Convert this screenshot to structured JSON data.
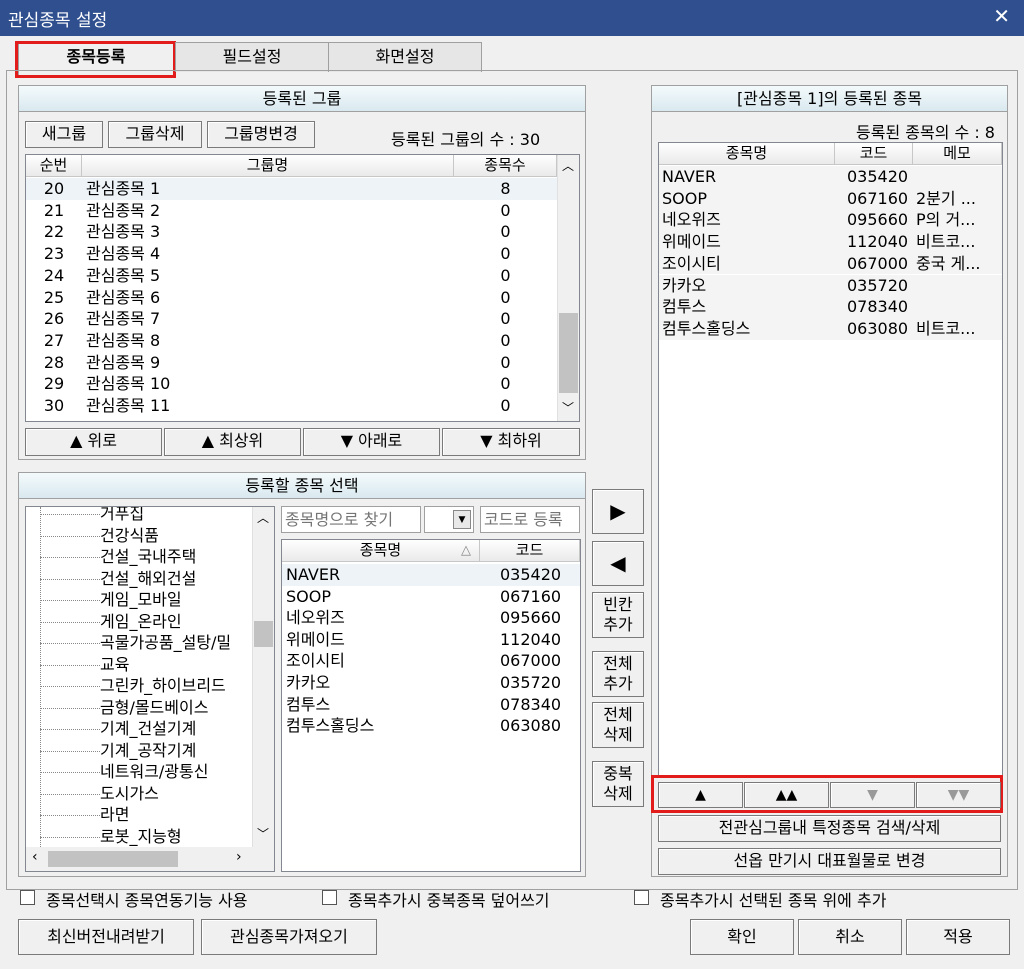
{
  "window": {
    "title": "관심종목 설정",
    "close": "✕"
  },
  "tabs": [
    {
      "label": "종목등록",
      "active": true
    },
    {
      "label": "필드설정",
      "active": false
    },
    {
      "label": "화면설정",
      "active": false
    }
  ],
  "groups": {
    "title": "등록된 그룹",
    "buttons": {
      "new": "새그룹",
      "delete": "그룹삭제",
      "rename": "그룹명변경"
    },
    "count_label": "등록된 그룹의 수 : 30",
    "columns": [
      "순번",
      "그룹명",
      "종목수"
    ],
    "rows": [
      [
        "20",
        "관심종목 1",
        "8"
      ],
      [
        "21",
        "관심종목 2",
        "0"
      ],
      [
        "22",
        "관심종목 3",
        "0"
      ],
      [
        "23",
        "관심종목 4",
        "0"
      ],
      [
        "24",
        "관심종목 5",
        "0"
      ],
      [
        "25",
        "관심종목 6",
        "0"
      ],
      [
        "26",
        "관심종목 7",
        "0"
      ],
      [
        "27",
        "관심종목 8",
        "0"
      ],
      [
        "28",
        "관심종목 9",
        "0"
      ],
      [
        "29",
        "관심종목 10",
        "0"
      ],
      [
        "30",
        "관심종목 11",
        "0"
      ]
    ],
    "move": {
      "up": "▲ 위로",
      "top": "▲ 최상위",
      "down": "▼ 아래로",
      "bottom": "▼ 최하위"
    }
  },
  "select": {
    "title": "등록할 종목 선택",
    "tree": [
      "거푸집",
      "건강식품",
      "건설_국내주택",
      "건설_해외건설",
      "게임_모바일",
      "게임_온라인",
      "곡물가공품_설탕/밀",
      "교육",
      "그린카_하이브리드",
      "금형/몰드베이스",
      "기계_건설기계",
      "기계_공작기계",
      "네트워크/광통신",
      "도시가스",
      "라면",
      "로봇_지능형"
    ],
    "search_name_placeholder": "종목명으로 찾기",
    "search_code_placeholder": "코드로 등록",
    "columns": [
      "종목명",
      "코드"
    ],
    "sort_indicator": "△",
    "rows": [
      [
        "NAVER",
        "035420"
      ],
      [
        "SOOP",
        "067160"
      ],
      [
        "네오위즈",
        "095660"
      ],
      [
        "위메이드",
        "112040"
      ],
      [
        "조이시티",
        "067000"
      ],
      [
        "카카오",
        "035720"
      ],
      [
        "컴투스",
        "078340"
      ],
      [
        "컴투스홀딩스",
        "063080"
      ]
    ]
  },
  "middle": {
    "add": "▶",
    "remove": "◀",
    "blank_add": [
      "빈칸",
      "추가"
    ],
    "all_add": [
      "전체",
      "추가"
    ],
    "all_delete": [
      "전체",
      "삭제"
    ],
    "dup_delete": [
      "중복",
      "삭제"
    ]
  },
  "registered": {
    "title": "[관심종목 1]의 등록된 종목",
    "count_label": "등록된 종목의 수 : 8",
    "columns": [
      "종목명",
      "코드",
      "메모"
    ],
    "rows": [
      [
        "NAVER",
        "035420",
        ""
      ],
      [
        "SOOP",
        "067160",
        "2분기 ..."
      ],
      [
        "네오위즈",
        "095660",
        "P의 거..."
      ],
      [
        "위메이드",
        "112040",
        "비트코..."
      ],
      [
        "조이시티",
        "067000",
        "중국 게..."
      ],
      [
        "카카오",
        "035720",
        ""
      ],
      [
        "컴투스",
        "078340",
        ""
      ],
      [
        "컴투스홀딩스",
        "063080",
        "비트코..."
      ]
    ],
    "order": {
      "up": "▲",
      "top": "▲▲",
      "down": "▼",
      "bottom": "▼▼"
    },
    "search_delete": "전관심그룹내 특정종목 검색/삭제",
    "expiry_change": "선옵 만기시 대표월물로 변경"
  },
  "options": [
    "종목선택시 종목연동기능 사용",
    "종목추가시 중복종목 덮어쓰기",
    "종목추가시 선택된 종목 위에 추가"
  ],
  "footer": {
    "download": "최신버전내려받기",
    "import": "관심종목가져오기",
    "ok": "확인",
    "cancel": "취소",
    "apply": "적용"
  }
}
